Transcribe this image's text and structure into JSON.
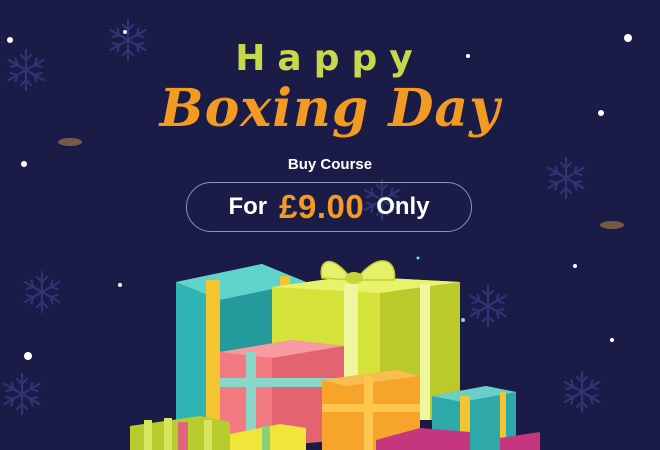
{
  "banner": {
    "headline_line1": "Happy",
    "headline_line2": "Boxing Day",
    "subheading": "Buy Course",
    "offer": {
      "prefix": "For",
      "price": "£9.00",
      "suffix": "Only"
    }
  },
  "colors": {
    "background": "#1b1b47",
    "headline_green": "#c7d84a",
    "accent_orange": "#f39a22",
    "text_white": "#ffffff"
  },
  "icons": [
    "snowflake-icon",
    "gift-box-icon"
  ]
}
